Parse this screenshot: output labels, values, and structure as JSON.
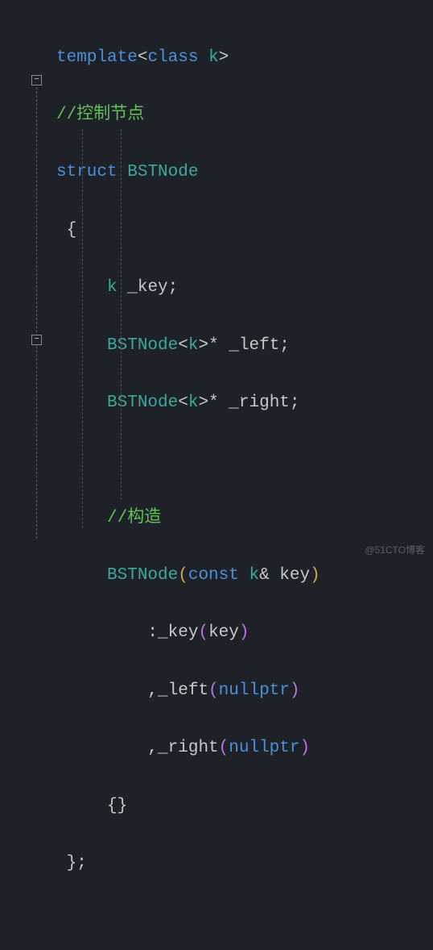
{
  "watermark": "@51CTO博客",
  "tokens": {
    "template": "template",
    "class": "class",
    "k": "k",
    "comment1": "//控制节点",
    "struct": "struct",
    "BSTNode": "BSTNode",
    "lbrace": "{",
    "rbrace": "}",
    "semicolon": ";",
    "star": "*",
    "amp": "&",
    "lt": "<",
    "gt": ">",
    "_key": "_key",
    "_left": "_left",
    "_right": "_right",
    "comment2": "//构造",
    "const": "const",
    "key": "key",
    "colon": ":",
    "comma": ",",
    "lparen": "(",
    "rparen": ")",
    "nullptr": "nullptr",
    "space": " ",
    "emptybraces": "{}",
    "structend": "};"
  },
  "fold_minus": "−"
}
